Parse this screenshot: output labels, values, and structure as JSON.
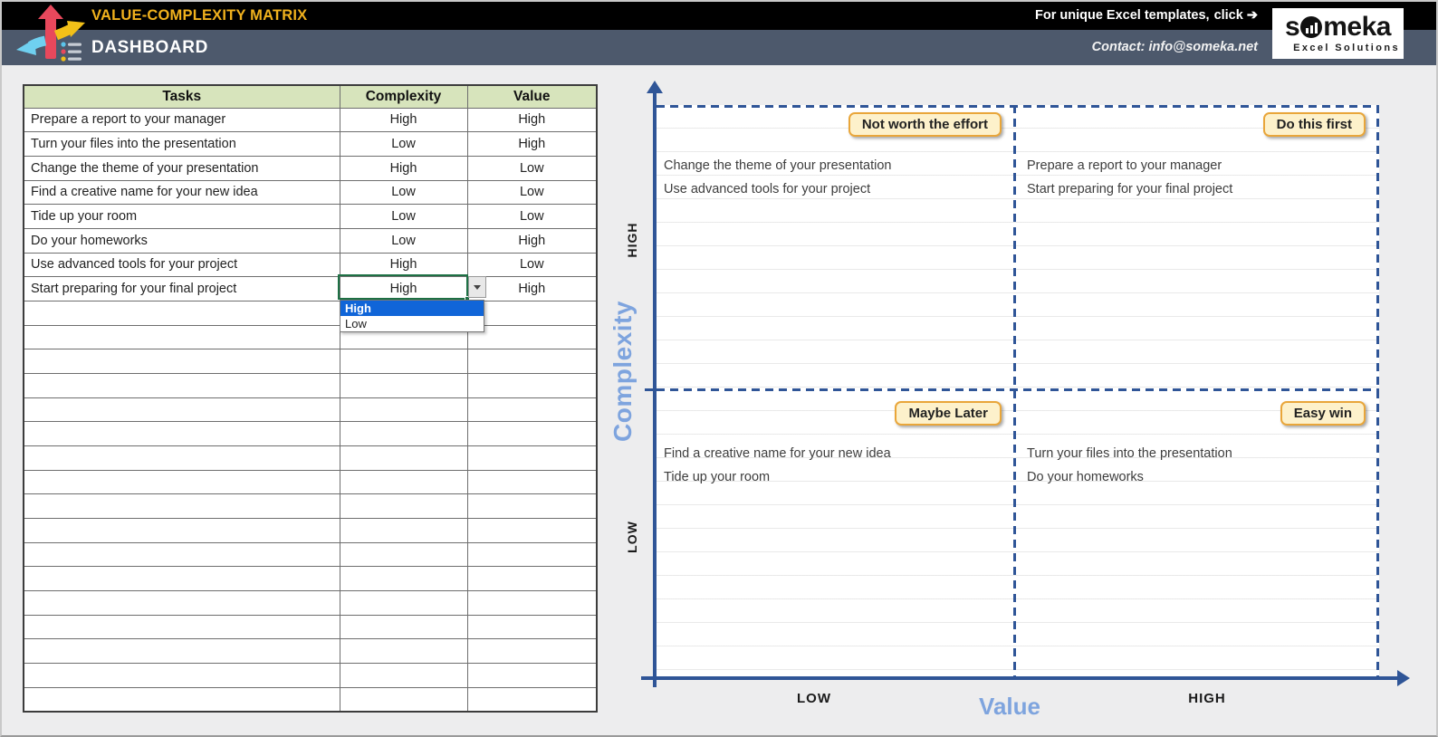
{
  "header": {
    "title": "VALUE-COMPLEXITY MATRIX",
    "subtitle": "DASHBOARD",
    "promo_text": "For unique Excel templates,",
    "promo_click": "click ➔",
    "contact": "Contact: info@someka.net",
    "brand": {
      "full_name": "someka",
      "name_prefix": "s",
      "name_suffix": "meka",
      "tagline": "Excel Solutions"
    }
  },
  "colors": {
    "title_gold": "#f0b11d",
    "slate_bar": "#4d596c",
    "table_header_green": "#d7e4bc",
    "axis_blue": "#2f5597",
    "axis_title_blue": "#7ea4de",
    "badge_bg": "#fdf1cb",
    "badge_border": "#e9a63a",
    "selection_green": "#1e7145",
    "dropdown_highlight": "#1065d8"
  },
  "table": {
    "columns": [
      "Tasks",
      "Complexity",
      "Value"
    ],
    "rows": [
      {
        "task": "Prepare a report to your manager",
        "complexity": "High",
        "value": "High"
      },
      {
        "task": "Turn your files into the presentation",
        "complexity": "Low",
        "value": "High"
      },
      {
        "task": "Change the theme of your presentation",
        "complexity": "High",
        "value": "Low"
      },
      {
        "task": "Find a creative name for your new idea",
        "complexity": "Low",
        "value": "Low"
      },
      {
        "task": "Tide up your room",
        "complexity": "Low",
        "value": "Low"
      },
      {
        "task": "Do your homeworks",
        "complexity": "Low",
        "value": "High"
      },
      {
        "task": "Use advanced tools for your project",
        "complexity": "High",
        "value": "Low"
      },
      {
        "task": "Start preparing for your final project",
        "complexity": "High",
        "value": "High"
      }
    ],
    "empty_row_count": 17,
    "active_cell": {
      "row_index": 7,
      "column": "Complexity",
      "value": "High"
    }
  },
  "dropdown": {
    "options": [
      "High",
      "Low"
    ],
    "selected": "High"
  },
  "chart_data": {
    "type": "quadrant",
    "title": "Value-Complexity Matrix",
    "xlabel": "Value",
    "ylabel": "Complexity",
    "x_ticks": [
      "LOW",
      "HIGH"
    ],
    "y_ticks": [
      "LOW",
      "HIGH"
    ],
    "grid": "dashed quadrant dividers",
    "quadrants": [
      {
        "position": "top-left",
        "x": "LOW",
        "y": "HIGH",
        "label": "Not worth the effort",
        "items": [
          "Change the theme of your presentation",
          "Use advanced tools for your project"
        ]
      },
      {
        "position": "top-right",
        "x": "HIGH",
        "y": "HIGH",
        "label": "Do this first",
        "items": [
          "Prepare a report to your manager",
          "Start preparing for your final project"
        ]
      },
      {
        "position": "bottom-left",
        "x": "LOW",
        "y": "LOW",
        "label": "Maybe Later",
        "items": [
          "Find a creative name for your new idea",
          "Tide up your room"
        ]
      },
      {
        "position": "bottom-right",
        "x": "HIGH",
        "y": "LOW",
        "label": "Easy win",
        "items": [
          "Turn your files into the presentation",
          "Do your homeworks"
        ]
      }
    ]
  }
}
